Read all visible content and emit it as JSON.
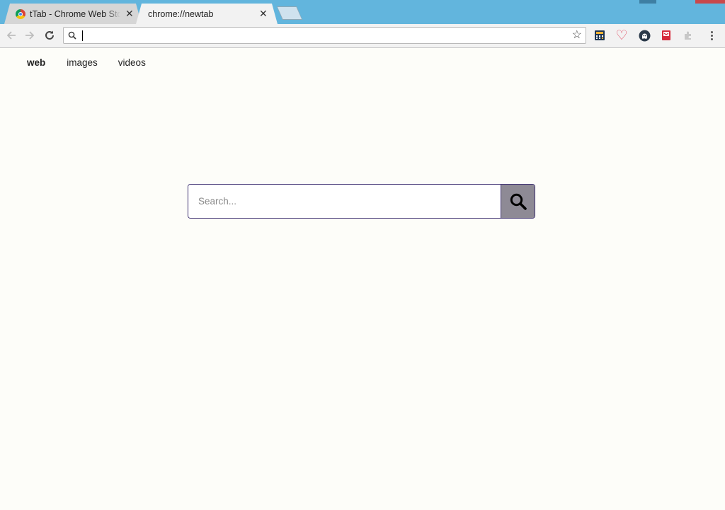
{
  "browser": {
    "tabs": [
      {
        "title": "tTab - Chrome Web Store",
        "active": false
      },
      {
        "title": "chrome://newtab",
        "active": true
      }
    ],
    "omnibox": {
      "value": ""
    },
    "extension_icons": [
      "calculator-extension-icon",
      "heart-extension-icon",
      "ghostery-extension-icon",
      "pocket-extension-icon",
      "puzzle-extension-icon"
    ]
  },
  "page": {
    "nav": {
      "web": "web",
      "images": "images",
      "videos": "videos"
    },
    "search": {
      "placeholder": "Search..."
    }
  },
  "colors": {
    "title_bar": "#62b5dd",
    "search_border": "#3d2f70",
    "search_button": "#8e8a95",
    "page_background": "#fdfdf9"
  }
}
